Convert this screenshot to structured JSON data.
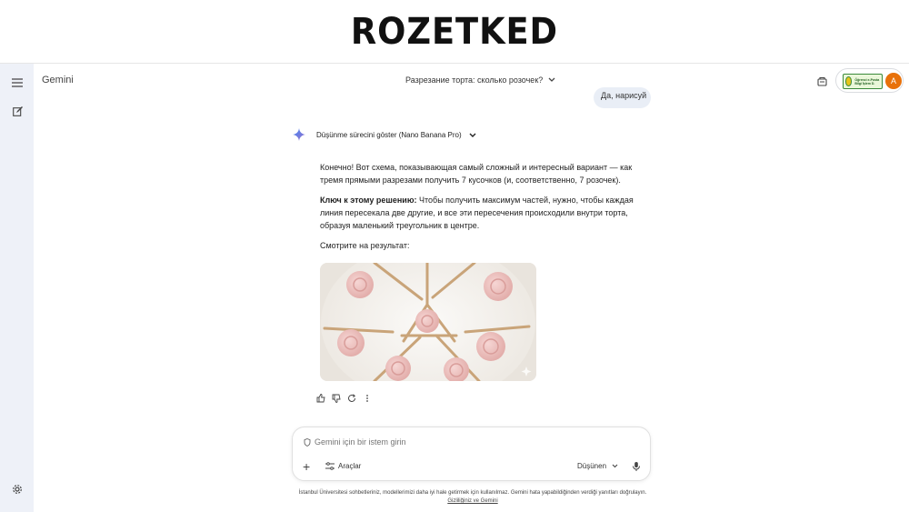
{
  "banner": {
    "logo": "ROZETKED"
  },
  "header": {
    "app_title": "Gemini",
    "chat_title": "Разрезание торта: сколько розочек?",
    "institution_badge": "Öğrenci e-Posta Bilgi İşlem D.",
    "avatar_letter": "A"
  },
  "user_message": {
    "text": "Да, нарисуй"
  },
  "response": {
    "thinking_label": "Düşünme sürecini göster (Nano Banana Pro)",
    "paragraph1": "Конечно! Вот схема, показывающая самый сложный и интересный вариант — как тремя прямыми разрезами получить 7 кусочков (и, соответственно, 7 розочек).",
    "key_label": "Ключ к этому решению:",
    "paragraph2": " Чтобы получить максимум частей, нужно, чтобы каждая линия пересекала две другие, и все эти пересечения происходили внутри торта, образуя маленький треугольник в центре.",
    "paragraph3": "Смотрите на результат:"
  },
  "input": {
    "placeholder": "Gemini için bir istem girin",
    "tools_label": "Araçlar",
    "mode_label": "Düşünen"
  },
  "footer": {
    "disclaimer": "İstanbul Üniversitesi sohbetleriniz, modellerimizi daha iyi hale getirmek için kullanılmaz. Gemini hata yapabildiğinden verdiği yanıtları doğrulayın.",
    "privacy_link": "Gizliliğiniz ve Gemini"
  },
  "colors": {
    "rail_bg": "#eef1f8",
    "bubble_bg": "#e9eef6",
    "avatar_bg": "#e8710a",
    "gemini_blue": "#4285f4"
  }
}
